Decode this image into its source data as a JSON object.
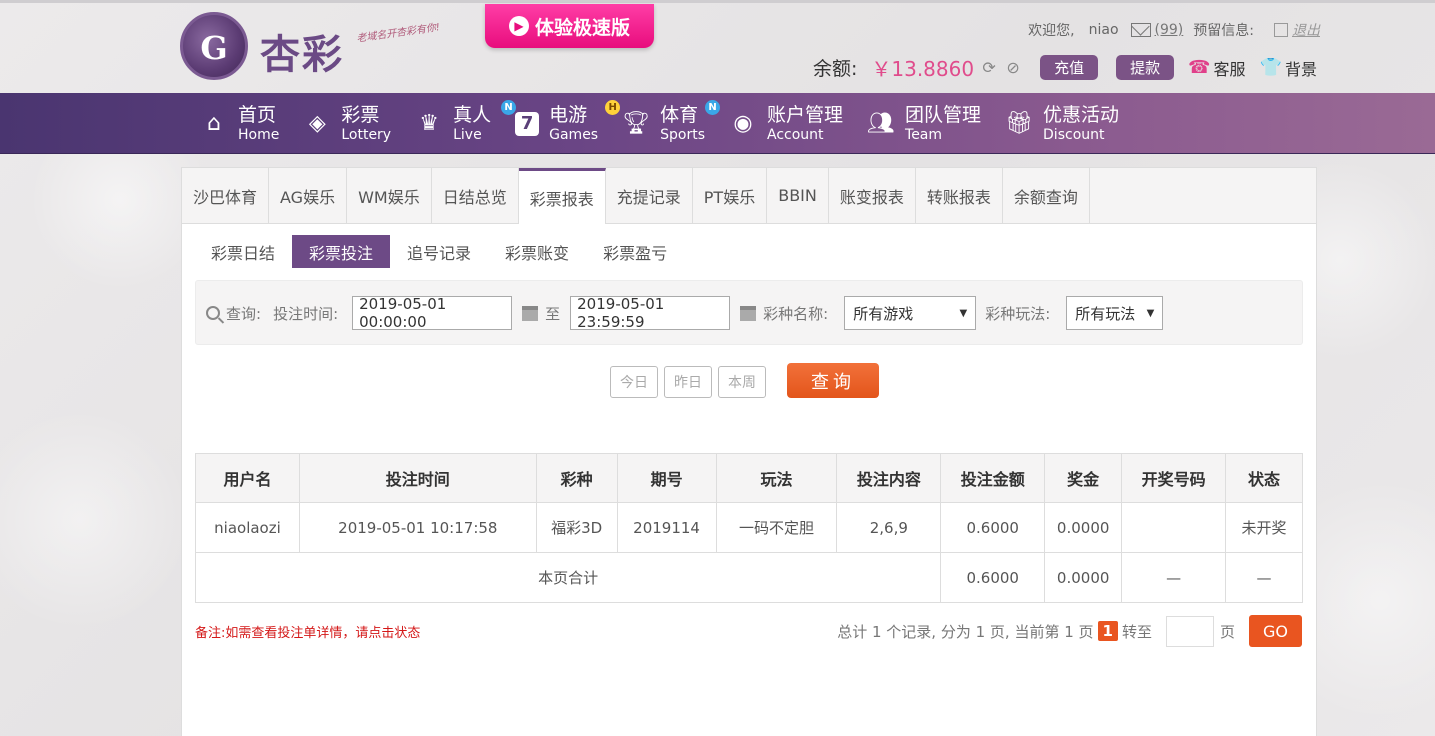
{
  "header": {
    "logo_text": "杏彩",
    "logo_slogan": "老域名开杏彩有你!",
    "promo_badge": "体验极速版",
    "welcome": "欢迎您,",
    "username": "niao",
    "message_count": "(99)",
    "reserved_info": "预留信息:",
    "logout": "退出",
    "balance_label": "余额:",
    "balance_value": "￥13.8860",
    "recharge": "充值",
    "withdraw": "提款",
    "service": "客服",
    "background": "背景"
  },
  "nav": [
    {
      "cn": "首页",
      "en": "Home",
      "icon": "home-icon",
      "badge": ""
    },
    {
      "cn": "彩票",
      "en": "Lottery",
      "icon": "lottery-ticket-icon",
      "badge": ""
    },
    {
      "cn": "真人",
      "en": "Live",
      "icon": "live-dealer-icon",
      "badge": "N"
    },
    {
      "cn": "电游",
      "en": "Games",
      "icon": "slot-seven-icon",
      "badge": "H"
    },
    {
      "cn": "体育",
      "en": "Sports",
      "icon": "trophy-icon",
      "badge": "N"
    },
    {
      "cn": "账户管理",
      "en": "Account",
      "icon": "account-icon",
      "badge": ""
    },
    {
      "cn": "团队管理",
      "en": "Team",
      "icon": "team-icon",
      "badge": ""
    },
    {
      "cn": "优惠活动",
      "en": "Discount",
      "icon": "gift-icon",
      "badge": ""
    }
  ],
  "tabs": [
    "沙巴体育",
    "AG娱乐",
    "WM娱乐",
    "日结总览",
    "彩票报表",
    "充提记录",
    "PT娱乐",
    "BBIN",
    "账变报表",
    "转账报表",
    "余额查询"
  ],
  "active_tab": "彩票报表",
  "subtabs": [
    "彩票日结",
    "彩票投注",
    "追号记录",
    "彩票账变",
    "彩票盈亏"
  ],
  "active_subtab": "彩票投注",
  "query": {
    "label": "查询:",
    "bet_time_label": "投注时间:",
    "start_time": "2019-05-01 00:00:00",
    "to": "至",
    "end_time": "2019-05-01 23:59:59",
    "game_name_label": "彩种名称:",
    "game_name_value": "所有游戏",
    "play_label": "彩种玩法:",
    "play_value": "所有玩法",
    "today": "今日",
    "yesterday": "昨日",
    "this_week": "本周",
    "search": "查询"
  },
  "table": {
    "headers": [
      "用户名",
      "投注时间",
      "彩种",
      "期号",
      "玩法",
      "投注内容",
      "投注金额",
      "奖金",
      "开奖号码",
      "状态"
    ],
    "rows": [
      [
        "niaolaozi",
        "2019-05-01 10:17:58",
        "福彩3D",
        "2019114",
        "一码不定胆",
        "2,6,9",
        "0.6000",
        "0.0000",
        "",
        "未开奖"
      ]
    ],
    "subtotal": {
      "label": "本页合计",
      "amount": "0.6000",
      "bonus": "0.0000",
      "draw": "—",
      "status": "—"
    }
  },
  "note": "备注:如需查看投注单详情，请点击状态",
  "pager": {
    "summary": "总计 1 个记录, 分为 1 页, 当前第 1 页",
    "current": "1",
    "goto": "转至",
    "page_unit": "页",
    "go": "GO"
  }
}
